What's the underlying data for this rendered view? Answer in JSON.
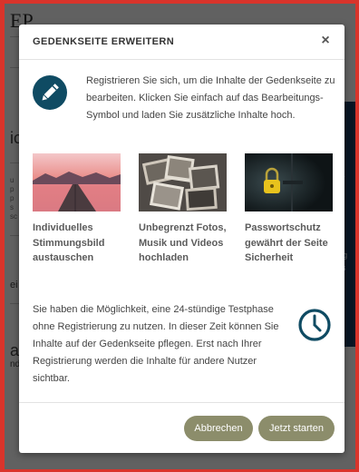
{
  "background": {
    "logo": "EP",
    "fragments": [
      "ic",
      "ei",
      "ag",
      "nd"
    ],
    "side_fragments": [
      "tz",
      "x",
      "no",
      "erg",
      "eis",
      "tzt"
    ]
  },
  "modal": {
    "title": "GEDENKSEITE ERWEITERN",
    "close_label": "×",
    "intro_text": "Registrieren Sie sich, um die Inhalte der Gedenkseite zu bearbeiten. Klicken Sie einfach auf das Bearbeitungs-Symbol und laden Sie zusätzliche Inhalte hoch.",
    "features": [
      {
        "label": "Individuelles Stimmungsbild austauschen",
        "icon": "pier-sunset-image"
      },
      {
        "label": "Unbegrenzt Fotos, Musik und Videos hochladen",
        "icon": "photos-image"
      },
      {
        "label": "Passwortschutz gewährt der Seite Sicherheit",
        "icon": "padlock-image"
      }
    ],
    "trial_text": "Sie haben die Möglichkeit, eine 24-stündige Testphase ohne Registrierung zu nutzen. In dieser Zeit können Sie Inhalte auf der Gedenkseite pflegen. Erst nach Ihrer Registrierung werden die Inhalte für andere Nutzer sichtbar.",
    "cancel_label": "Abbrechen",
    "start_label": "Jetzt starten"
  },
  "colors": {
    "accent": "#0f4b63",
    "button": "#8c8d6b",
    "frame": "#d9342b"
  }
}
